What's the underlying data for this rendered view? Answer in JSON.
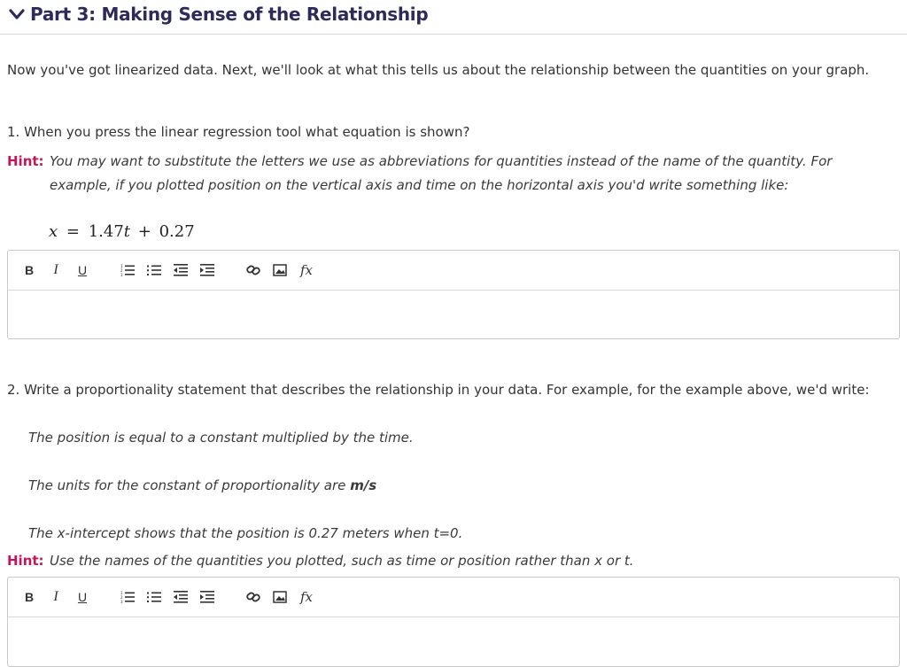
{
  "part": {
    "title": "Part 3: Making Sense of the Relationship",
    "icon": "chevron-down-icon"
  },
  "intro": "Now you've got linearized data. Next, we'll look at what this tells us about the relationship  between the quantities on your graph.",
  "q1": {
    "question": "1. When you press the linear regression tool what equation is shown?",
    "hint_label": "Hint:",
    "hint_text": "You may want to substitute the letters we use as abbreviations for quantities instead of the name of the quantity. For example, if you plotted position on the vertical axis and time on the horizontal axis you'd write something like:",
    "equation": {
      "lhs": "x",
      "eq": "=",
      "coef": "1.47",
      "var": "t",
      "plus": "+",
      "const": "0.27"
    }
  },
  "toolbar": {
    "bold_label": "B",
    "italic_label": "I",
    "underline_label": "U",
    "fx_label": "fx"
  },
  "q2": {
    "question": "2. Write a proportionality statement that describes the relationship in your data. For example, for the example above, we'd write:",
    "example1": "The position is equal to a constant multiplied by the time.",
    "example2_prefix": "The units for the constant of proportionality are",
    "example2_units": "m/s",
    "example3": "The x-intercept shows that the position is 0.27 meters when t=0.",
    "hint_label": "Hint:",
    "hint_text": "Use the names of the quantities you plotted, such as time or position rather than x or t."
  },
  "colors": {
    "title": "#2e2a5a",
    "hint": "#c2185b",
    "border": "#c9c9c9"
  }
}
